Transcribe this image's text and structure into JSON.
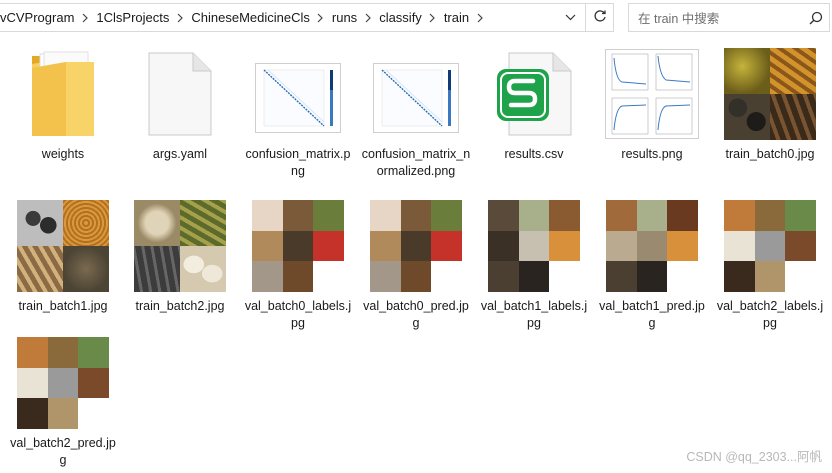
{
  "addressbar": {
    "crumbs": [
      "vCVProgram",
      "1ClsProjects",
      "ChineseMedicineCls",
      "runs",
      "classify",
      "train"
    ]
  },
  "search": {
    "placeholder": "在 train 中搜索"
  },
  "files": [
    {
      "name": "weights",
      "kind": "folder"
    },
    {
      "name": "args.yaml",
      "kind": "document"
    },
    {
      "name": "confusion_matrix.png",
      "kind": "image"
    },
    {
      "name": "confusion_matrix_normalized.png",
      "kind": "image"
    },
    {
      "name": "results.csv",
      "kind": "spreadsheet"
    },
    {
      "name": "results.png",
      "kind": "image"
    },
    {
      "name": "train_batch0.jpg",
      "kind": "image"
    },
    {
      "name": "train_batch1.jpg",
      "kind": "image"
    },
    {
      "name": "train_batch2.jpg",
      "kind": "image"
    },
    {
      "name": "val_batch0_labels.jpg",
      "kind": "image"
    },
    {
      "name": "val_batch0_pred.jpg",
      "kind": "image"
    },
    {
      "name": "val_batch1_labels.jpg",
      "kind": "image"
    },
    {
      "name": "val_batch1_pred.jpg",
      "kind": "image"
    },
    {
      "name": "val_batch2_labels.jpg",
      "kind": "image"
    },
    {
      "name": "val_batch2_pred.jpg",
      "kind": "image"
    }
  ],
  "watermark": "CSDN @qq_2303...阿帆",
  "colors": {
    "folder": "#f4c44e",
    "wps_green": "#1fa34a"
  }
}
